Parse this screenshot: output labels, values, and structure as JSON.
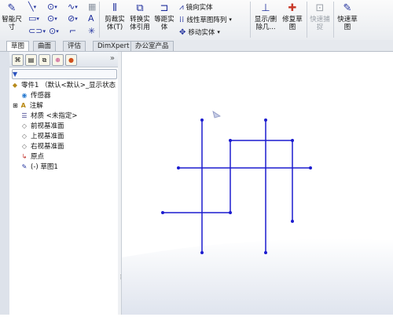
{
  "ribbon": {
    "smart_dim": {
      "label": "智能尺",
      "sublabel": "寸"
    },
    "trim": {
      "label": "剪裁实",
      "sublabel": "体(T)"
    },
    "convert": {
      "label": "转换实",
      "sublabel": "体引用"
    },
    "offset": {
      "label": "等距实",
      "sublabel": "体"
    },
    "mirror": {
      "label": "镜向实体"
    },
    "linear_pattern": {
      "label": "线性草图阵列"
    },
    "move": {
      "label": "移动实体"
    },
    "display_delete": {
      "label": "显示/删",
      "sublabel": "除几..."
    },
    "repair": {
      "label": "修复草",
      "sublabel": "图"
    },
    "quick_snap": {
      "label": "快速捕",
      "sublabel": "捉"
    },
    "rapid_sketch": {
      "label": "快速草",
      "sublabel": "图"
    }
  },
  "tabs": [
    {
      "label": "草图",
      "active": true
    },
    {
      "label": "曲面",
      "active": false
    },
    {
      "label": "评估",
      "active": false
    },
    {
      "label": "DimXpert",
      "active": false
    },
    {
      "label": "办公室产品",
      "active": false
    }
  ],
  "panel": {
    "tree": [
      {
        "label": "零件1 （默认<默认>_显示状态",
        "icon": "part-icon"
      },
      {
        "label": "传感器",
        "icon": "sensor-icon"
      },
      {
        "label": "注解",
        "icon": "annotation-icon"
      },
      {
        "label": "材质 <未指定>",
        "icon": "material-icon"
      },
      {
        "label": "前视基准面",
        "icon": "plane-icon"
      },
      {
        "label": "上视基准面",
        "icon": "plane-icon"
      },
      {
        "label": "右视基准面",
        "icon": "plane-icon"
      },
      {
        "label": "原点",
        "icon": "origin-icon"
      },
      {
        "label": "(-) 草图1",
        "icon": "sketch-icon"
      }
    ]
  },
  "sketch": {
    "line_color": "#1c1ccf"
  }
}
